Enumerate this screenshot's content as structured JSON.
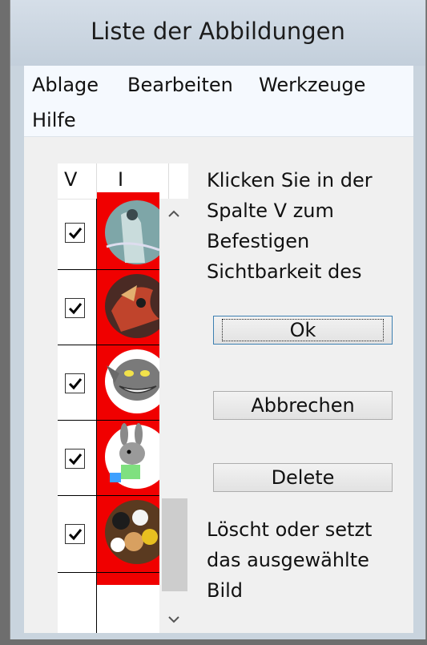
{
  "window": {
    "title": "Liste der Abbildungen"
  },
  "menu": {
    "items": [
      {
        "label": "Ablage"
      },
      {
        "label": "Bearbeiten"
      },
      {
        "label": "Werkzeuge"
      },
      {
        "label": "Hilfe"
      }
    ]
  },
  "grid": {
    "columns": [
      {
        "label": "V"
      },
      {
        "label": "I"
      }
    ],
    "rows": [
      {
        "visible": true,
        "image": "woman-in-water-thumbnail"
      },
      {
        "visible": true,
        "image": "dragon-thumbnail"
      },
      {
        "visible": true,
        "image": "cheshire-cat-thumbnail"
      },
      {
        "visible": true,
        "image": "grey-donkey-thumbnail"
      },
      {
        "visible": true,
        "image": "cartoon-characters-thumbnail"
      }
    ]
  },
  "hint": {
    "text": "Klicken Sie in der Spalte V zum Befestigen Sichtbarkeit des Bild..."
  },
  "buttons": {
    "ok": "Ok",
    "cancel": "Abbrechen",
    "delete": "Delete"
  },
  "description": {
    "text": "Löscht oder setzt das ausgewählte Bild"
  },
  "colors": {
    "grid_image_background": "#f00000",
    "menubar": "#f5f9fe",
    "titlebar": "#c9d4de"
  }
}
